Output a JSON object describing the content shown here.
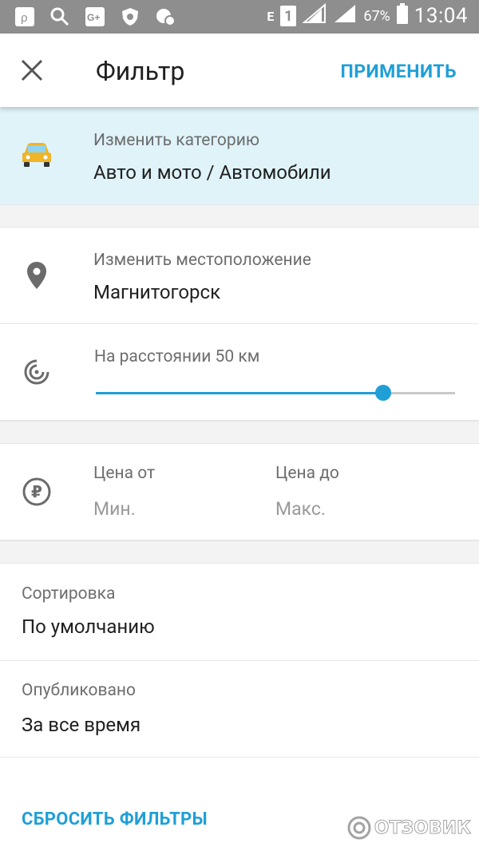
{
  "status_bar": {
    "network_label": "E",
    "sim_label": "1",
    "battery": "67%",
    "time": "13:04"
  },
  "toolbar": {
    "title": "Фильтр",
    "apply_label": "ПРИМЕНИТЬ"
  },
  "category": {
    "label": "Изменить категорию",
    "value": "Авто и мото / Автомобили"
  },
  "location": {
    "label": "Изменить местоположение",
    "value": "Магнитогорск"
  },
  "distance": {
    "label": "На расстоянии 50 км",
    "slider_fraction": 0.8
  },
  "price": {
    "from_label": "Цена от",
    "from_placeholder": "Мин.",
    "to_label": "Цена до",
    "to_placeholder": "Макс."
  },
  "sort": {
    "label": "Сортировка",
    "value": "По умолчанию"
  },
  "published": {
    "label": "Опубликовано",
    "value": "За все время"
  },
  "reset_label": "СБРОСИТЬ ФИЛЬТРЫ",
  "watermark": "ОТЗОВИК",
  "colors": {
    "accent": "#1f9fd6",
    "category_bg": "#dff3f9",
    "status_bar": "#8e8e8e"
  }
}
